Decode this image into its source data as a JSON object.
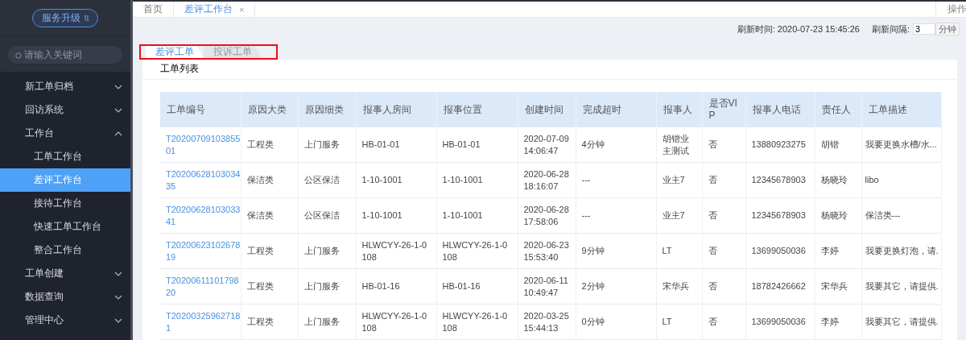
{
  "sidebar": {
    "upgrade_button": "服务升级",
    "search": {
      "placeholder": "请输入关键词"
    },
    "items": [
      {
        "label": "新工单归档",
        "expanded": false,
        "selected": false
      },
      {
        "label": "回访系统",
        "expanded": false,
        "selected": false
      },
      {
        "label": "工作台",
        "expanded": true,
        "selected": false,
        "children": [
          {
            "label": "工单工作台",
            "selected": false
          },
          {
            "label": "差评工作台",
            "selected": true
          },
          {
            "label": "接待工作台",
            "selected": false
          },
          {
            "label": "快速工单工作台",
            "selected": false
          },
          {
            "label": "整合工作台",
            "selected": false
          }
        ]
      },
      {
        "label": "工单创建",
        "expanded": false,
        "selected": false
      },
      {
        "label": "数据查询",
        "expanded": false,
        "selected": false
      },
      {
        "label": "管理中心",
        "expanded": false,
        "selected": false
      }
    ]
  },
  "tabs": [
    {
      "label": "首页",
      "selected": false
    },
    {
      "label": "差评工作台",
      "selected": true,
      "close": "×"
    }
  ],
  "tab_bar_action": "操作",
  "refresh": {
    "time_label": "刷新时间: 2020-07-23 15:45:26",
    "interval_label": "刷新间隔:",
    "interval_value": "3",
    "unit": "分钟"
  },
  "subtabs": {
    "highlighted": true,
    "items": [
      {
        "label": "差评工单",
        "selected": true
      },
      {
        "label": "投诉工单",
        "selected": false
      }
    ]
  },
  "panel": {
    "title": "工单列表"
  },
  "table": {
    "columns": [
      "工单编号",
      "原因大类",
      "原因细类",
      "报事人房间",
      "报事位置",
      "创建时间",
      "完成超时",
      "报事人",
      "是否VIP",
      "报事人电话",
      "责任人",
      "工单描述"
    ],
    "rows": [
      [
        "T2020070910385501",
        "工程类",
        "上门服务",
        "HB-01-01",
        "HB-01-01",
        "2020-07-09 14:06:47",
        "4分钟",
        "胡锴业主测试",
        "否",
        "13880923275",
        "胡锴",
        "我要更换水槽/水..."
      ],
      [
        "T2020062810303435",
        "保洁类",
        "公区保洁",
        "1-10-1001",
        "1-10-1001",
        "2020-06-28 18:16:07",
        "---",
        "业主7",
        "否",
        "12345678903",
        "杨晓玲",
        "libo"
      ],
      [
        "T2020062810303341",
        "保洁类",
        "公区保洁",
        "1-10-1001",
        "1-10-1001",
        "2020-06-28 17:58:06",
        "---",
        "业主7",
        "否",
        "12345678903",
        "杨晓玲",
        "保洁类---"
      ],
      [
        "T2020062310267819",
        "工程类",
        "上门服务",
        "HLWCYY-26-1-0108",
        "HLWCYY-26-1-0108",
        "2020-06-23 15:53:40",
        "9分钟",
        "LT",
        "否",
        "13699050036",
        "李婷",
        "我要更换灯泡，请."
      ],
      [
        "T2020061110179820",
        "工程类",
        "上门服务",
        "HB-01-16",
        "HB-01-16",
        "2020-06-11 10:49:47",
        "2分钟",
        "宋华兵",
        "否",
        "18782426662",
        "宋华兵",
        "我要其它，请提供."
      ],
      [
        "T202003259627181",
        "工程类",
        "上门服务",
        "HLWCYY-26-1-0108",
        "HLWCYY-26-1-0108",
        "2020-03-25 15:44:13",
        "0分钟",
        "LT",
        "否",
        "13699050036",
        "李婷",
        "我要其它，请提供."
      ]
    ]
  }
}
